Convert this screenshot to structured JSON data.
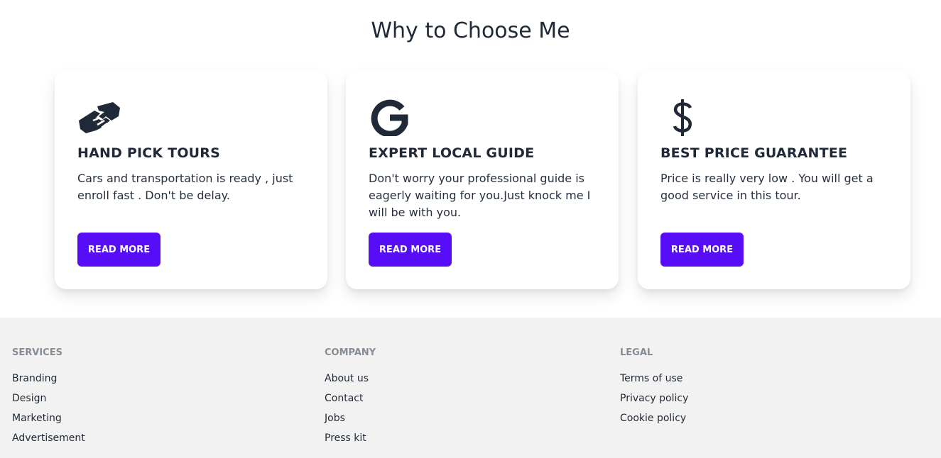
{
  "section": {
    "title": "Why to Choose Me"
  },
  "cards": [
    {
      "title": "HAND PICK TOURS",
      "text": "Cars and transportation is ready , just enroll fast . Don't be delay.",
      "button": "READ MORE",
      "icon": "handshake-icon"
    },
    {
      "title": "EXPERT LOCAL GUIDE",
      "text": "Don't worry your professional guide is eagerly waiting for you.Just knock me I will be with you.",
      "button": "READ MORE",
      "icon": "google-icon"
    },
    {
      "title": "BEST PRICE GUARANTEE",
      "text": "Price is really very low . You will get a good service in this tour.",
      "button": "READ MORE",
      "icon": "dollar-icon"
    }
  ],
  "footer": {
    "services": {
      "title": "SERVICES",
      "links": [
        "Branding",
        "Design",
        "Marketing",
        "Advertisement"
      ]
    },
    "company": {
      "title": "COMPANY",
      "links": [
        "About us",
        "Contact",
        "Jobs",
        "Press kit"
      ]
    },
    "legal": {
      "title": "LEGAL",
      "links": [
        "Terms of use",
        "Privacy policy",
        "Cookie policy"
      ]
    }
  },
  "colors": {
    "accent": "#570df8",
    "text": "#1f2937",
    "footer_bg": "#f2f2f2",
    "footer_heading": "#858c95"
  }
}
